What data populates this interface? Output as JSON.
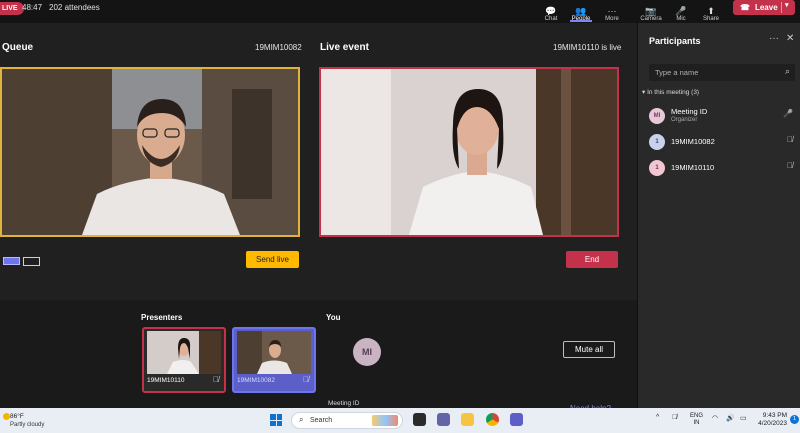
{
  "topbar": {
    "live_badge": "LIVE",
    "timer": "48:47",
    "attendees": "202 attendees",
    "buttons": [
      {
        "label": "Chat",
        "icon": "chat-icon"
      },
      {
        "label": "People",
        "icon": "people-icon"
      },
      {
        "label": "More",
        "icon": "more-icon"
      },
      {
        "label": "Camera",
        "icon": "camera-off-icon"
      },
      {
        "label": "Mic",
        "icon": "mic-icon"
      },
      {
        "label": "Share",
        "icon": "share-icon"
      }
    ],
    "leave_label": "Leave"
  },
  "queue": {
    "title": "Queue",
    "participant_id": "19MIM10082",
    "send_live_label": "Send live"
  },
  "live_event": {
    "title": "Live event",
    "status": "19MIM10110 is live",
    "end_label": "End"
  },
  "presenters": {
    "label": "Presenters",
    "items": [
      {
        "name": "19MIM10110"
      },
      {
        "name": "19MIM10082"
      }
    ]
  },
  "you": {
    "label": "You",
    "initials": "MI",
    "name": "Meeting ID"
  },
  "mute_all_label": "Mute all",
  "need_help_label": "Need help?",
  "participants": {
    "title": "Participants",
    "more": "···",
    "close": "✕",
    "search_placeholder": "Type a name",
    "group_label": "In this meeting (3)",
    "list": [
      {
        "initials": "MI",
        "name": "Meeting ID",
        "role": "Organizer",
        "color": "#e8c8d8"
      },
      {
        "initials": "1",
        "name": "19MIM10082",
        "role": "",
        "color": "#c9d2ea"
      },
      {
        "initials": "1",
        "name": "19MIM10110",
        "role": "",
        "color": "#f0c6d2"
      }
    ]
  },
  "taskbar": {
    "temperature": "86°F",
    "weather": "Partly cloudy",
    "search_label": "Search",
    "lang_top": "ENG",
    "lang_bottom": "IN",
    "time": "9:43 PM",
    "date": "4/20/2023",
    "notification_count": "1"
  }
}
